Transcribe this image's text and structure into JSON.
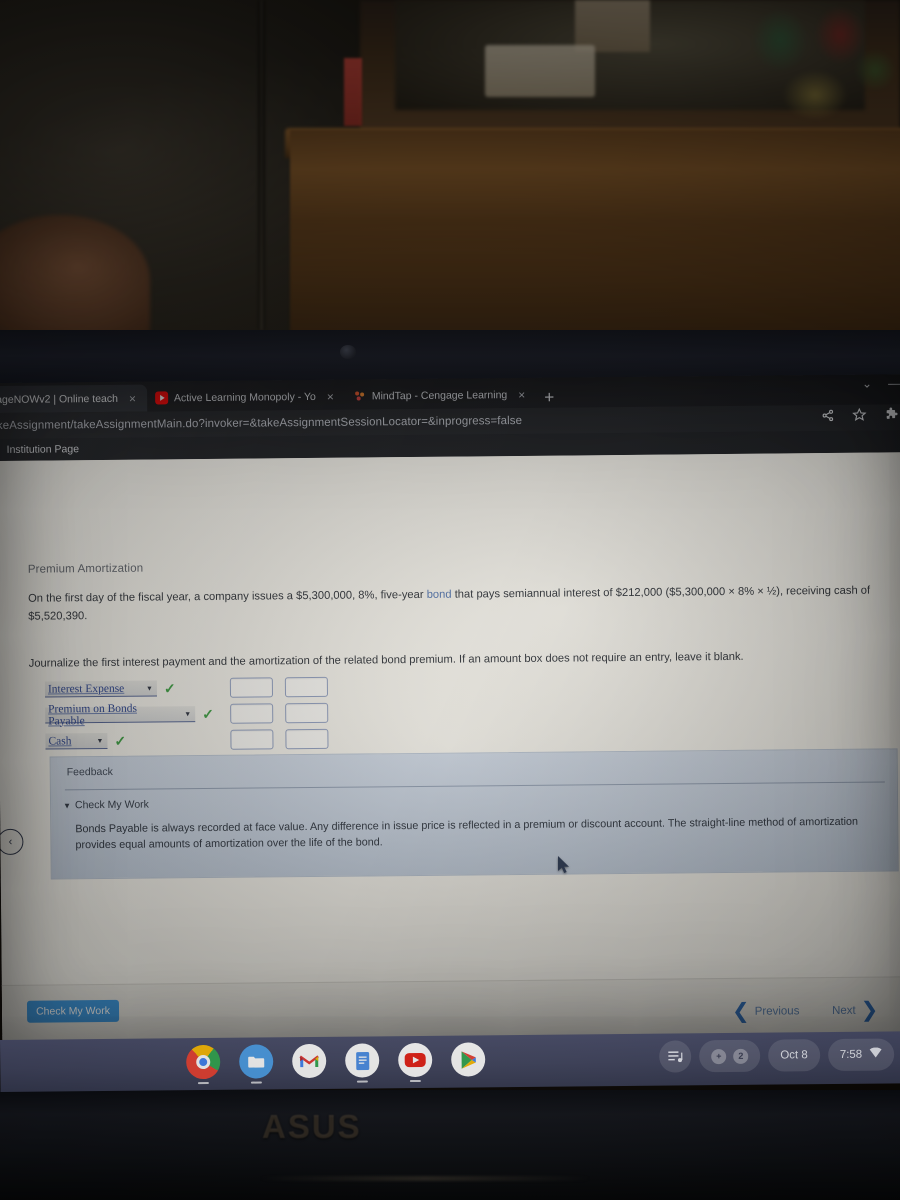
{
  "browser": {
    "tabs": [
      {
        "title": "ageNOWv2 | Online teach",
        "favicon": "cengage-icon",
        "active": true,
        "close_label": "×"
      },
      {
        "title": "Active Learning Monopoly - Yo",
        "favicon": "youtube-icon",
        "active": false,
        "close_label": "×"
      },
      {
        "title": "MindTap - Cengage Learning",
        "favicon": "mindtap-icon",
        "active": false,
        "close_label": "×"
      }
    ],
    "new_tab_label": "+",
    "window_controls": {
      "expand": "⌄",
      "minimize": "—"
    },
    "url": "akeAssignment/takeAssignmentMain.do?invoker=&takeAssignmentSessionLocator=&inprogress=false",
    "toolbar_icons": [
      "share-icon",
      "bookmark-star-icon",
      "extensions-puzzle-icon"
    ],
    "bookmarks": [
      {
        "label": "Institution Page"
      }
    ]
  },
  "assignment": {
    "heading": "Premium Amortization",
    "problem_part1": "On the first day of the fiscal year, a company issues a $5,300,000, 8%, five-year ",
    "problem_link": "bond",
    "problem_part2": " that pays semiannual interest of $212,000 ($5,300,000 × 8% × ½), receiving cash of $5,520,390.",
    "instruction": "Journalize the first interest payment and the amortization of the related bond premium. If an amount box does not require an entry, leave it blank.",
    "journal_rows": [
      {
        "account": "Interest Expense",
        "width_class": "w-a",
        "status": "✓",
        "debit": "",
        "credit": ""
      },
      {
        "account": "Premium on Bonds Payable",
        "width_class": "w-b",
        "status": "✓",
        "debit": "",
        "credit": ""
      },
      {
        "account": "Cash",
        "width_class": "w-c",
        "status": "✓",
        "debit": "",
        "credit": ""
      }
    ],
    "dropdown_caret": "▼",
    "feedback": {
      "title": "Feedback",
      "expander_label": "Check My Work",
      "expander_triangle": "▼",
      "body": "Bonds Payable is always recorded at face value. Any difference in issue price is reflected in a premium or discount account. The straight-line method of amortization provides equal amounts of amortization over the life of the bond."
    },
    "collapse_handle": "‹",
    "footer": {
      "check_my_work": "Check My Work",
      "previous": "Previous",
      "next": "Next",
      "prev_chevron": "❮",
      "next_chevron": "❯"
    }
  },
  "shelf": {
    "apps": [
      {
        "name": "chrome-icon",
        "glyph": ""
      },
      {
        "name": "files-icon",
        "glyph": "🗀"
      },
      {
        "name": "gmail-icon",
        "glyph": "M"
      },
      {
        "name": "docs-icon",
        "glyph": "☰"
      },
      {
        "name": "youtube-icon",
        "glyph": "▶"
      },
      {
        "name": "play-store-icon",
        "glyph": "▶"
      }
    ],
    "tray": {
      "notifications_icon": "playlist-icon",
      "badge_count": "2",
      "badge_plus": "+",
      "date": "Oct 8",
      "time": "7:58",
      "wifi_icon": "wifi-icon"
    }
  },
  "device": {
    "brand": "ASUS"
  }
}
